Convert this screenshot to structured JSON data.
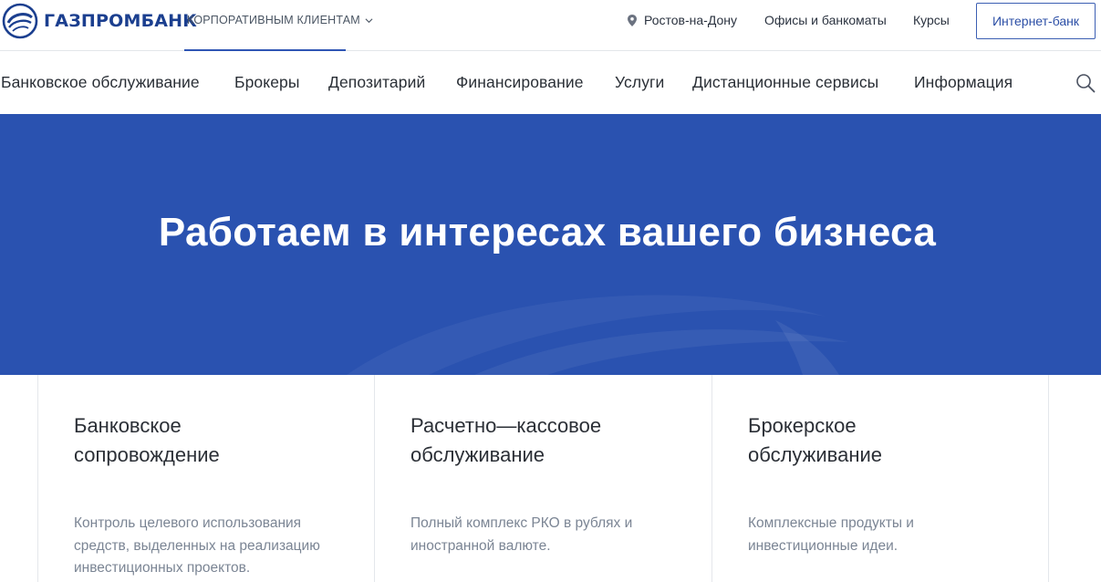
{
  "brand": {
    "name": "ГАЗПРОМБАНК",
    "accent_color": "#1b3f8f",
    "hero_color": "#2a52b0"
  },
  "topbar": {
    "segment_label": "КОРПОРАТИВНЫМ КЛИЕНТАМ",
    "city": "Ростов-на-Дону",
    "links": [
      "Офисы и банкоматы",
      "Курсы"
    ],
    "internet_bank_label": "Интернет-банк"
  },
  "mainnav": {
    "items": [
      "Банковское обслуживание",
      "Брокеры",
      "Депозитарий",
      "Финансирование",
      "Услуги",
      "Дистанционные сервисы",
      "Информация"
    ]
  },
  "hero": {
    "title": "Работаем в интересах вашего бизнеса"
  },
  "cards": [
    {
      "title_line1": "Банковское",
      "title_line2": "сопровождение",
      "desc_line1": "Контроль целевого использования",
      "desc_line2": "средств, выделенных на реализацию",
      "desc_line3": "инвестиционных проектов."
    },
    {
      "title_line1": "Расчетно—кассовое",
      "title_line2": "обслуживание",
      "desc_line1": "Полный комплекс РКО в рублях и",
      "desc_line2": "иностранной валюте.",
      "desc_line3": ""
    },
    {
      "title_line1": "Брокерское",
      "title_line2": "обслуживание",
      "desc_line1": "Комплексные продукты и",
      "desc_line2": "инвестиционные идеи.",
      "desc_line3": ""
    }
  ]
}
